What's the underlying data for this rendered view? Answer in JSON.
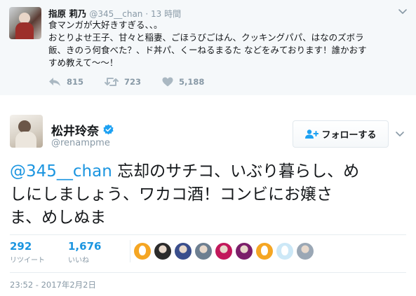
{
  "parent_tweet": {
    "name": "指原 莉乃",
    "handle": "@345__chan",
    "time": "· 13 時間",
    "text_lines": [
      "食マンガが大好きすぎる、、。",
      "おとりよせ王子、甘々と稲妻、ごほうびごはん、クッキングパパ、はなのズボラ",
      "飯、きのう何食べた？、ド丼パ、くーねるまるた などをみております！誰かおす",
      "すめ教えて〜〜！"
    ],
    "replies": "815",
    "retweets": "723",
    "likes": "5,188"
  },
  "main_tweet": {
    "name": "松井玲奈",
    "handle": "@renampme",
    "follow_label": "フォローする",
    "mention": "@345__chan",
    "text_lines": [
      " 忘却のサチコ、いぶり暮らし、め",
      "しにしましょう、ワカコ酒！コンビにお嬢さ",
      "ま、めしぬま"
    ],
    "retweet_count": "292",
    "retweet_label": "リツイート",
    "like_count": "1,676",
    "like_label": "いいね",
    "timestamp": "23:52 - 2017年2月2日"
  },
  "likers": [
    {
      "kind": "egg",
      "color": "#f5a623"
    },
    {
      "kind": "photo",
      "color": "#2b2b2b"
    },
    {
      "kind": "photo",
      "color": "#3a4e8c"
    },
    {
      "kind": "photo",
      "color": "#6d7f91"
    },
    {
      "kind": "photo",
      "color": "#c2185b"
    },
    {
      "kind": "photo",
      "color": "#7b1f6a"
    },
    {
      "kind": "egg",
      "color": "#f5a623"
    },
    {
      "kind": "egg",
      "color": "#cce8f7"
    },
    {
      "kind": "photo",
      "color": "#9aa7b5"
    }
  ],
  "colors": {
    "link": "#1b95e0",
    "muted": "#8899a6",
    "verified": "#1da1f2"
  }
}
